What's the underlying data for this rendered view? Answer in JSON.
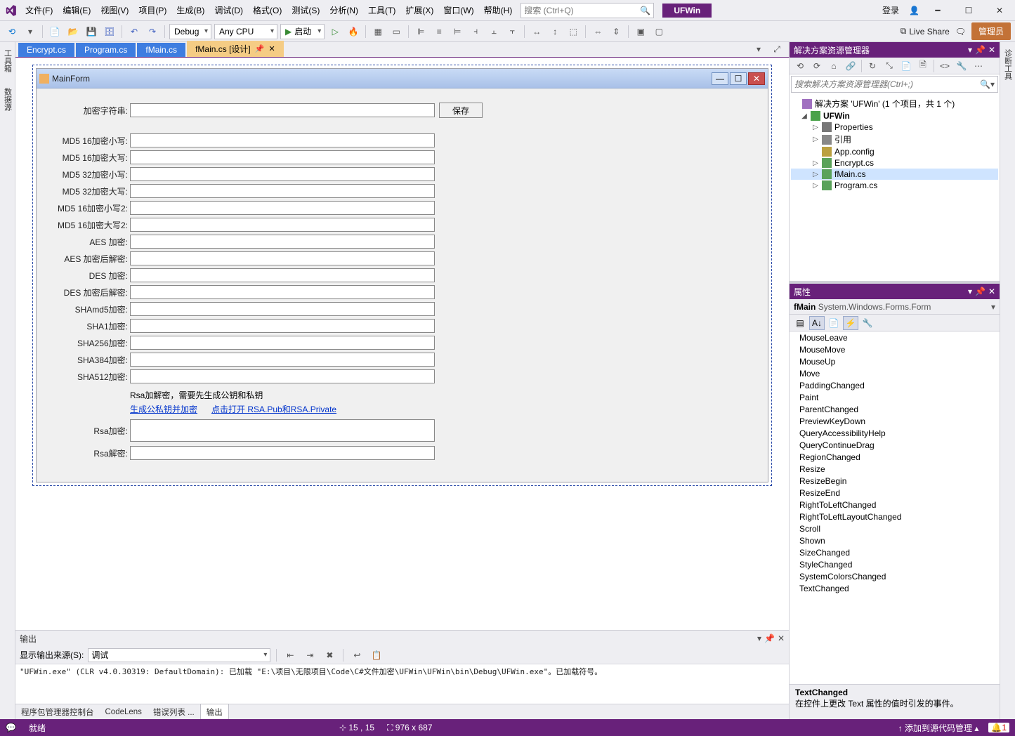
{
  "menu": [
    "文件(F)",
    "编辑(E)",
    "视图(V)",
    "项目(P)",
    "生成(B)",
    "调试(D)",
    "格式(O)",
    "测试(S)",
    "分析(N)",
    "工具(T)",
    "扩展(X)",
    "窗口(W)",
    "帮助(H)"
  ],
  "searchPlaceholder": "搜索 (Ctrl+Q)",
  "appName": "UFWin",
  "login": "登录",
  "adminBadge": "管理员",
  "toolbar": {
    "debug": "Debug",
    "anyCpu": "Any CPU",
    "start": "启动",
    "liveShare": "Live Share"
  },
  "leftTabs": [
    "工具箱",
    "数据源"
  ],
  "rightTabs": [
    "诊断工具"
  ],
  "docTabs": {
    "t1": "Encrypt.cs",
    "t2": "Program.cs",
    "t3": "fMain.cs",
    "active": "fMain.cs [设计]"
  },
  "form": {
    "title": "MainForm",
    "saveBtn": "保存",
    "labels": {
      "encStr": "加密字符串:",
      "md516l": "MD5 16加密小写:",
      "md516u": "MD5 16加密大写:",
      "md532l": "MD5 32加密小写:",
      "md532u": "MD5 32加密大写:",
      "md516l2": "MD5 16加密小写2:",
      "md516u2": "MD5 16加密大写2:",
      "aesEnc": "AES 加密:",
      "aesDec": "AES 加密后解密:",
      "desEnc": "DES 加密:",
      "desDec": "DES 加密后解密:",
      "shaMd5": "SHAmd5加密:",
      "sha1": "SHA1加密:",
      "sha256": "SHA256加密:",
      "sha384": "SHA384加密:",
      "sha512": "SHA512加密:",
      "rsaNote": "Rsa加解密，需要先生成公钥和私钥",
      "genLink": "生成公私钥并加密",
      "openLink": "点击打开 RSA.Pub和RSA.Private",
      "rsaEnc": "Rsa加密:",
      "rsaDec": "Rsa解密:"
    }
  },
  "solution": {
    "title": "解决方案资源管理器",
    "searchPh": "搜索解决方案资源管理器(Ctrl+;)",
    "root": "解决方案 'UFWin' (1 个项目，共 1 个)",
    "proj": "UFWin",
    "items": [
      "Properties",
      "引用",
      "App.config",
      "Encrypt.cs",
      "fMain.cs",
      "Program.cs"
    ]
  },
  "properties": {
    "title": "属性",
    "object": "fMain",
    "type": "System.Windows.Forms.Form",
    "events": [
      "MouseLeave",
      "MouseMove",
      "MouseUp",
      "Move",
      "PaddingChanged",
      "Paint",
      "ParentChanged",
      "PreviewKeyDown",
      "QueryAccessibilityHelp",
      "QueryContinueDrag",
      "RegionChanged",
      "Resize",
      "ResizeBegin",
      "ResizeEnd",
      "RightToLeftChanged",
      "RightToLeftLayoutChanged",
      "Scroll",
      "Shown",
      "SizeChanged",
      "StyleChanged",
      "SystemColorsChanged",
      "TextChanged"
    ],
    "descHead": "TextChanged",
    "descBody": "在控件上更改 Text 属性的值时引发的事件。"
  },
  "output": {
    "title": "输出",
    "sourceLabel": "显示输出来源(S):",
    "sourceValue": "调试",
    "log": "\"UFWin.exe\" (CLR v4.0.30319: DefaultDomain): 已加载 \"E:\\项目\\无限项目\\Code\\C#文件加密\\UFWin\\UFWin\\bin\\Debug\\UFWin.exe\"。已加载符号。"
  },
  "bottomTabs": [
    "程序包管理器控制台",
    "CodeLens",
    "错误列表 ...",
    "输出"
  ],
  "status": {
    "ready": "就绪",
    "pos": "15 , 15",
    "size": "976 x 687",
    "add": "添加到源代码管理"
  }
}
